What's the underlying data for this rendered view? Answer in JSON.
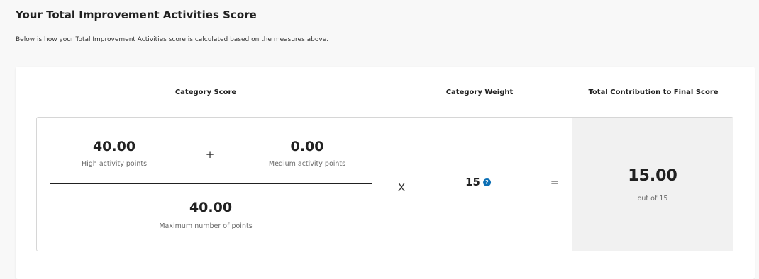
{
  "section": {
    "title": "Your Total Improvement Activities Score",
    "description": "Below is how your Total Improvement Activities score is calculated based on the measures above."
  },
  "headers": {
    "category_score": "Category Score",
    "category_weight": "Category Weight",
    "total_contribution": "Total Contribution to Final Score"
  },
  "calculation": {
    "high_points_value": "40.00",
    "high_points_label": "High activity points",
    "plus_operator": "+",
    "medium_points_value": "0.00",
    "medium_points_label": "Medium activity points",
    "max_points_value": "40.00",
    "max_points_label": "Maximum number of points",
    "multiply_operator": "X",
    "weight_value": "15",
    "help_icon_glyph": "?",
    "equals_operator": "=",
    "result_value": "15.00",
    "result_label": "out of 15"
  },
  "colors": {
    "accent_help_icon": "#0b6fb5",
    "result_panel_bg": "#f1f1f1"
  }
}
